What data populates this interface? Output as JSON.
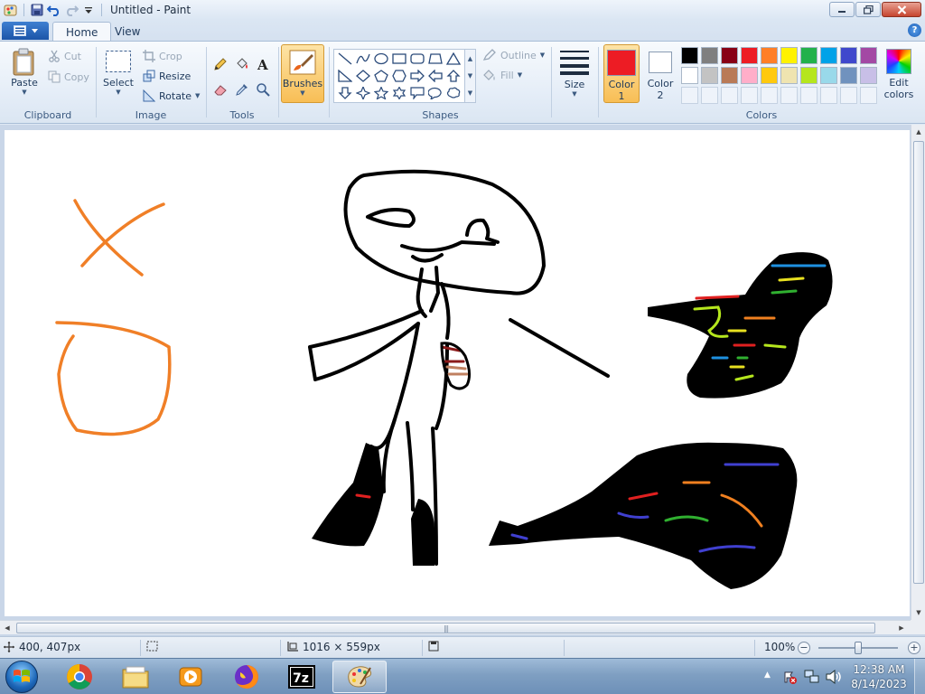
{
  "window": {
    "title": "Untitled - Paint"
  },
  "tabs": [
    {
      "label": "Home",
      "active": true
    },
    {
      "label": "View",
      "active": false
    }
  ],
  "ribbon": {
    "clipboard": {
      "label": "Clipboard",
      "paste": "Paste",
      "cut": "Cut",
      "copy": "Copy"
    },
    "image": {
      "label": "Image",
      "select": "Select",
      "crop": "Crop",
      "resize": "Resize",
      "rotate": "Rotate"
    },
    "tools": {
      "label": "Tools"
    },
    "brushes": {
      "label": "Brushes"
    },
    "shapes": {
      "label": "Shapes",
      "outline": "Outline",
      "fill": "Fill"
    },
    "size": {
      "label": "Size"
    },
    "colors": {
      "label": "Colors",
      "color1_line1": "Color",
      "color1_line2": "1",
      "color2_line1": "Color",
      "color2_line2": "2",
      "edit_line1": "Edit",
      "edit_line2": "colors",
      "color1": "#ed1c24",
      "color2": "#ffffff",
      "palette_row1": [
        "#000000",
        "#7f7f7f",
        "#880015",
        "#ed1c24",
        "#ff7f27",
        "#fff200",
        "#22b14c",
        "#00a2e8",
        "#3f48cc",
        "#a349a4"
      ],
      "palette_row2": [
        "#ffffff",
        "#c3c3c3",
        "#b97a57",
        "#ffaec9",
        "#ffc90e",
        "#efe4b0",
        "#b5e61d",
        "#99d9ea",
        "#7092be",
        "#c8bfe7"
      ]
    }
  },
  "status": {
    "cursor_pos": "400, 407px",
    "canvas_size": "1016 × 559px",
    "zoom": "100%"
  },
  "taskbar": {
    "time": "12:38 AM",
    "date": "8/14/2023",
    "apps": [
      "chrome",
      "file-explorer",
      "media-player",
      "firefox",
      "7-zip",
      "paint"
    ]
  }
}
